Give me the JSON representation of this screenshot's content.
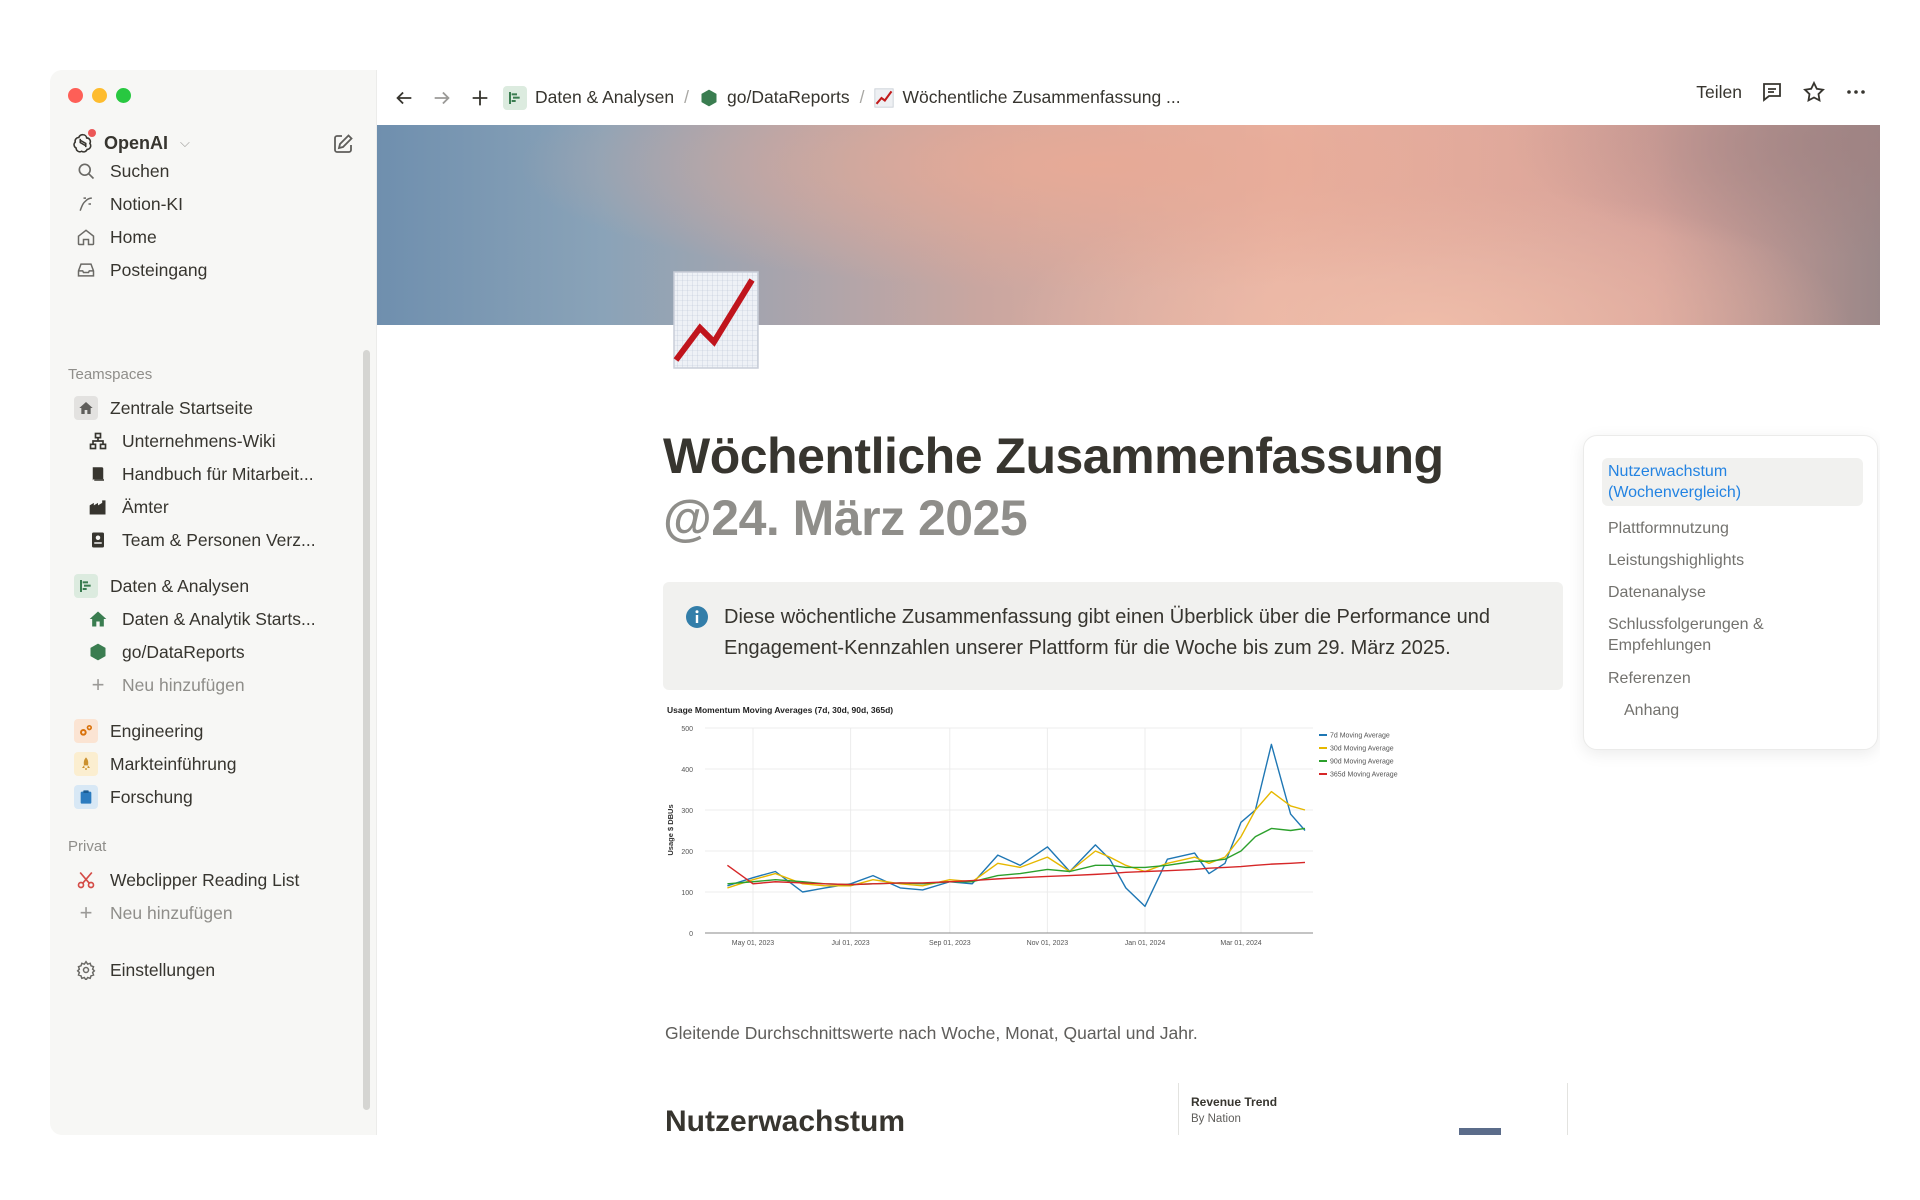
{
  "window": {
    "colors": {
      "close": "#fe5f57",
      "minimize": "#febc2e",
      "zoom": "#28c840"
    }
  },
  "sidebar": {
    "workspace_name": "OpenAI",
    "primary": [
      {
        "label": "Suchen",
        "icon": "search-icon"
      },
      {
        "label": "Notion-KI",
        "icon": "notion-ai-icon"
      },
      {
        "label": "Home",
        "icon": "home-icon"
      },
      {
        "label": "Posteingang",
        "icon": "inbox-icon"
      }
    ],
    "teamspaces_label": "Teamspaces",
    "teamspaces": [
      {
        "label": "Zentrale Startseite",
        "icon": "house-icon"
      },
      {
        "label": "Unternehmens-Wiki",
        "icon": "org-chart-icon"
      },
      {
        "label": "Handbuch für Mitarbeit...",
        "icon": "book-icon"
      },
      {
        "label": "Ämter",
        "icon": "buildings-icon"
      },
      {
        "label": "Team & Personen Verz...",
        "icon": "badge-icon"
      },
      {
        "label": "Daten & Analysen",
        "icon": "gantt-icon"
      },
      {
        "label": "Daten & Analytik Starts...",
        "icon": "house-icon"
      },
      {
        "label": "go/DataReports",
        "icon": "hexagon-icon"
      },
      {
        "label": "Neu hinzufügen",
        "icon": "plus-icon"
      },
      {
        "label": "Engineering",
        "icon": "gears-icon"
      },
      {
        "label": "Markteinführung",
        "icon": "rocket-icon"
      },
      {
        "label": "Forschung",
        "icon": "clipboard-icon"
      }
    ],
    "private_label": "Privat",
    "private": [
      {
        "label": "Webclipper Reading List",
        "icon": "scissors-icon"
      },
      {
        "label": "Neu hinzufügen",
        "icon": "plus-icon"
      }
    ],
    "settings_label": "Einstellungen"
  },
  "topbar": {
    "breadcrumbs": [
      "Daten & Analysen",
      "go/DataReports",
      "Wöchentliche Zusammenfassung ..."
    ],
    "share_label": "Teilen"
  },
  "page": {
    "title": "Wöchentliche Zusammenfassung",
    "date": "@24. März 2025",
    "callout": "Diese wöchentliche Zusammenfassung gibt einen Überblick über die Performance und Engagement-Kennzahlen unserer Plattform für die Woche bis zum 29. März 2025.",
    "caption": "Gleitende Durchschnittswerte nach Woche, Monat, Quartal und Jahr.",
    "heading": "Nutzerwachstum",
    "thumb_title": "Revenue Trend",
    "thumb_subtitle": "By Nation"
  },
  "toc": {
    "items": [
      "Nutzerwachstum (Wochenvergleich)",
      "Plattformnutzung",
      "Leistungshighlights",
      "Datenanalyse",
      "Schlussfolgerungen & Empfehlungen",
      "Referenzen",
      "Anhang"
    ],
    "active_color": "#2383e2"
  },
  "chart_data": {
    "type": "line",
    "title": "Usage Momentum Moving Averages (7d, 30d, 90d, 365d)",
    "ylabel": "Usage $ DBUs",
    "ylim": [
      0,
      500
    ],
    "yticks": [
      0,
      100,
      200,
      300,
      400,
      500
    ],
    "xticks": [
      "May 01, 2023",
      "Jul 01, 2023",
      "Sep 01, 2023",
      "Nov 01, 2023",
      "Jan 01, 2024",
      "Mar 01, 2024"
    ],
    "x": [
      "2023-04-15",
      "2023-05-01",
      "2023-05-15",
      "2023-06-01",
      "2023-06-15",
      "2023-07-01",
      "2023-07-15",
      "2023-08-01",
      "2023-08-15",
      "2023-09-01",
      "2023-09-15",
      "2023-10-01",
      "2023-10-15",
      "2023-11-01",
      "2023-11-15",
      "2023-12-01",
      "2023-12-10",
      "2023-12-20",
      "2024-01-01",
      "2024-01-15",
      "2024-02-01",
      "2024-02-10",
      "2024-02-20",
      "2024-03-01",
      "2024-03-10",
      "2024-03-20",
      "2024-04-01",
      "2024-04-10"
    ],
    "series": [
      {
        "name": "7d Moving Average",
        "color": "#1f77b4",
        "values": [
          115,
          135,
          150,
          100,
          110,
          120,
          140,
          110,
          105,
          125,
          120,
          190,
          165,
          210,
          150,
          215,
          180,
          110,
          65,
          180,
          195,
          145,
          170,
          270,
          300,
          460,
          290,
          250
        ]
      },
      {
        "name": "30d Moving Average",
        "color": "#e6b800",
        "values": [
          110,
          130,
          145,
          120,
          115,
          115,
          130,
          120,
          115,
          130,
          125,
          170,
          160,
          185,
          150,
          200,
          185,
          165,
          150,
          170,
          185,
          170,
          185,
          235,
          300,
          345,
          310,
          300
        ]
      },
      {
        "name": "90d Moving Average",
        "color": "#2ca02c",
        "values": [
          120,
          125,
          130,
          125,
          120,
          118,
          120,
          122,
          120,
          125,
          125,
          140,
          145,
          155,
          150,
          165,
          165,
          160,
          160,
          165,
          175,
          175,
          180,
          200,
          235,
          255,
          250,
          255
        ]
      },
      {
        "name": "365d Moving Average",
        "color": "#d62728",
        "values": [
          165,
          120,
          125,
          122,
          120,
          118,
          120,
          122,
          122,
          125,
          128,
          132,
          135,
          138,
          140,
          143,
          145,
          148,
          150,
          152,
          155,
          158,
          160,
          162,
          165,
          168,
          170,
          172
        ]
      }
    ]
  }
}
